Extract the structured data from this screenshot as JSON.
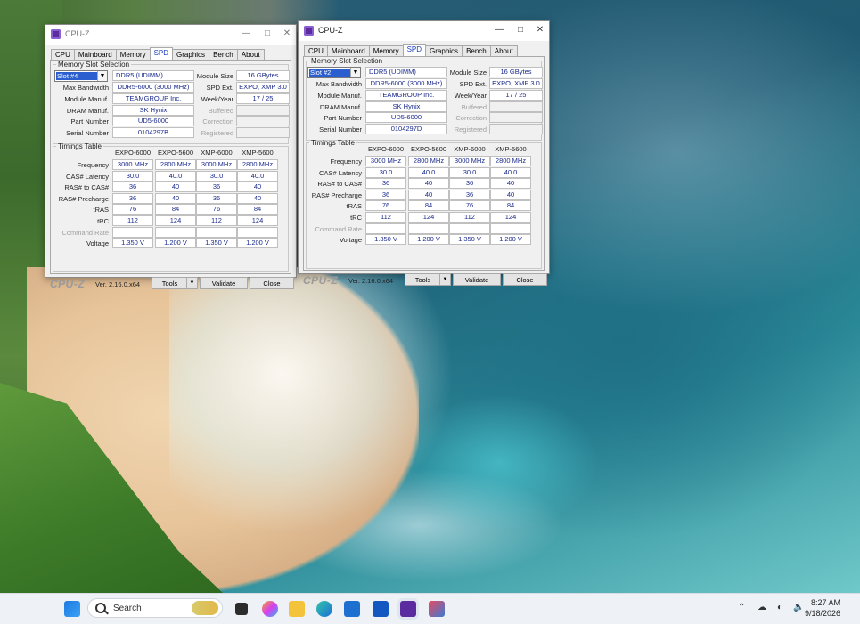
{
  "colors": {
    "accent_text": "#1a2a8c",
    "selection": "#2b5fd0",
    "tab_active_text": "#1a3fbf"
  },
  "windows": [
    {
      "title": "CPU-Z",
      "tabs": [
        "CPU",
        "Mainboard",
        "Memory",
        "SPD",
        "Graphics",
        "Bench",
        "About"
      ],
      "active_tab": "SPD",
      "memory_slot_group": "Memory Slot Selection",
      "slot": "Slot #4",
      "memory_type": "DDR5 (UDIMM)",
      "labels": {
        "module_size": "Module Size",
        "max_bandwidth": "Max Bandwidth",
        "spd_ext": "SPD Ext.",
        "module_manuf": "Module Manuf.",
        "week_year": "Week/Year",
        "dram_manuf": "DRAM Manuf.",
        "buffered": "Buffered",
        "part_number": "Part Number",
        "correction": "Correction",
        "serial_number": "Serial Number",
        "registered": "Registered"
      },
      "values": {
        "module_size": "16 GBytes",
        "max_bandwidth": "DDR5-6000 (3000 MHz)",
        "spd_ext": "EXPO, XMP 3.0",
        "module_manuf": "TEAMGROUP Inc.",
        "week_year": "17 / 25",
        "dram_manuf": "SK Hynix",
        "part_number": "UD5-6000",
        "serial_number": "0104297B"
      },
      "timings_group": "Timings Table",
      "timing_columns": [
        "EXPO-6000",
        "EXPO-5600",
        "XMP-6000",
        "XMP-5600"
      ],
      "timing_rows": [
        {
          "label": "Frequency",
          "values": [
            "3000 MHz",
            "2800 MHz",
            "3000 MHz",
            "2800 MHz"
          ]
        },
        {
          "label": "CAS# Latency",
          "values": [
            "30.0",
            "40.0",
            "30.0",
            "40.0"
          ]
        },
        {
          "label": "RAS# to CAS#",
          "values": [
            "36",
            "40",
            "36",
            "40"
          ]
        },
        {
          "label": "RAS# Precharge",
          "values": [
            "36",
            "40",
            "36",
            "40"
          ]
        },
        {
          "label": "tRAS",
          "values": [
            "76",
            "84",
            "76",
            "84"
          ]
        },
        {
          "label": "tRC",
          "values": [
            "112",
            "124",
            "112",
            "124"
          ]
        },
        {
          "label": "Command Rate",
          "values": [
            "",
            "",
            "",
            ""
          ]
        },
        {
          "label": "Voltage",
          "values": [
            "1.350 V",
            "1.200 V",
            "1.350 V",
            "1.200 V"
          ]
        }
      ],
      "footer": {
        "brand": "CPU-Z",
        "version": "Ver. 2.16.0.x64",
        "tools": "Tools",
        "validate": "Validate",
        "close": "Close"
      }
    },
    {
      "title": "CPU-Z",
      "tabs": [
        "CPU",
        "Mainboard",
        "Memory",
        "SPD",
        "Graphics",
        "Bench",
        "About"
      ],
      "active_tab": "SPD",
      "memory_slot_group": "Memory Slot Selection",
      "slot": "Slot #2",
      "memory_type": "DDR5 (UDIMM)",
      "labels": {
        "module_size": "Module Size",
        "max_bandwidth": "Max Bandwidth",
        "spd_ext": "SPD Ext.",
        "module_manuf": "Module Manuf.",
        "week_year": "Week/Year",
        "dram_manuf": "DRAM Manuf.",
        "buffered": "Buffered",
        "part_number": "Part Number",
        "correction": "Correction",
        "serial_number": "Serial Number",
        "registered": "Registered"
      },
      "values": {
        "module_size": "16 GBytes",
        "max_bandwidth": "DDR5-6000 (3000 MHz)",
        "spd_ext": "EXPO, XMP 3.0",
        "module_manuf": "TEAMGROUP Inc.",
        "week_year": "17 / 25",
        "dram_manuf": "SK Hynix",
        "part_number": "UD5-6000",
        "serial_number": "0104297D"
      },
      "timings_group": "Timings Table",
      "timing_columns": [
        "EXPO-6000",
        "EXPO-5600",
        "XMP-6000",
        "XMP-5600"
      ],
      "timing_rows": [
        {
          "label": "Frequency",
          "values": [
            "3000 MHz",
            "2800 MHz",
            "3000 MHz",
            "2800 MHz"
          ]
        },
        {
          "label": "CAS# Latency",
          "values": [
            "30.0",
            "40.0",
            "30.0",
            "40.0"
          ]
        },
        {
          "label": "RAS# to CAS#",
          "values": [
            "36",
            "40",
            "36",
            "40"
          ]
        },
        {
          "label": "RAS# Precharge",
          "values": [
            "36",
            "40",
            "36",
            "40"
          ]
        },
        {
          "label": "tRAS",
          "values": [
            "76",
            "84",
            "76",
            "84"
          ]
        },
        {
          "label": "tRC",
          "values": [
            "112",
            "124",
            "112",
            "124"
          ]
        },
        {
          "label": "Command Rate",
          "values": [
            "",
            "",
            "",
            ""
          ]
        },
        {
          "label": "Voltage",
          "values": [
            "1.350 V",
            "1.200 V",
            "1.350 V",
            "1.200 V"
          ]
        }
      ],
      "footer": {
        "brand": "CPU-Z",
        "version": "Ver. 2.16.0.x64",
        "tools": "Tools",
        "validate": "Validate",
        "close": "Close"
      }
    }
  ],
  "taskbar": {
    "search_placeholder": "Search",
    "apps": [
      "start-icon",
      "task-view-icon",
      "copilot-icon",
      "file-explorer-icon",
      "edge-icon",
      "store-icon",
      "outlook-icon",
      "cpu-z-icon",
      "snipping-tool-icon"
    ],
    "time": "8:27 AM",
    "date": "9/18/2026"
  }
}
